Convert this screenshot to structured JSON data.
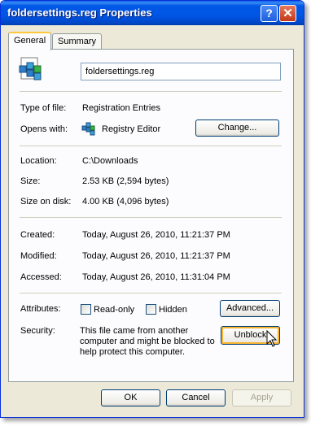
{
  "window": {
    "title": "foldersettings.reg Properties",
    "help_label": "?",
    "close_label": "✕"
  },
  "tabs": [
    {
      "label": "General",
      "active": true
    },
    {
      "label": "Summary",
      "active": false
    }
  ],
  "file": {
    "name": "foldersettings.reg",
    "icon": "registry-file-icon"
  },
  "type": {
    "label": "Type of file:",
    "value": "Registration Entries"
  },
  "opens": {
    "label": "Opens with:",
    "value": "Registry Editor",
    "icon": "registry-editor-icon",
    "button": "Change..."
  },
  "location": {
    "label": "Location:",
    "value": "C:\\Downloads"
  },
  "size": {
    "label": "Size:",
    "value": "2.53 KB (2,594 bytes)"
  },
  "size_on_disk": {
    "label": "Size on disk:",
    "value": "4.00 KB (4,096 bytes)"
  },
  "created": {
    "label": "Created:",
    "value": "Today, August 26, 2010, 11:21:37 PM"
  },
  "modified": {
    "label": "Modified:",
    "value": "Today, August 26, 2010, 11:21:37 PM"
  },
  "accessed": {
    "label": "Accessed:",
    "value": "Today, August 26, 2010, 11:31:04 PM"
  },
  "attributes": {
    "label": "Attributes:",
    "readonly": {
      "label": "Read-only",
      "checked": false
    },
    "hidden": {
      "label": "Hidden",
      "checked": false
    },
    "advanced_button": "Advanced..."
  },
  "security": {
    "label": "Security:",
    "text_line1": "This file came from another",
    "text_line2": "computer and might be blocked to",
    "text_line3": "help protect this computer.",
    "unblock_button": "Unblock"
  },
  "footer": {
    "ok": "OK",
    "cancel": "Cancel",
    "apply": "Apply"
  },
  "colors": {
    "titlebar": "#0055e5",
    "face": "#ece9d8",
    "focus": "#f8b330"
  }
}
